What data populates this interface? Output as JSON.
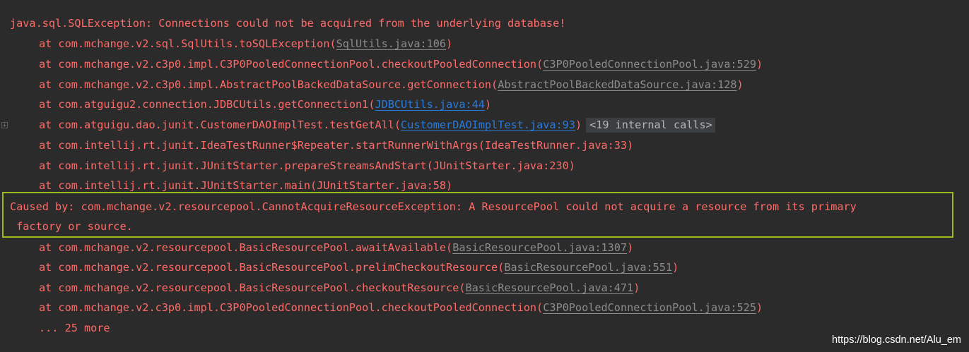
{
  "exception_header": "java.sql.SQLException: Connections could not be acquired from the underlying database!",
  "trace1": [
    {
      "method": "at com.mchange.v2.sql.SqlUtils.toSQLException(",
      "link": "SqlUtils.java:106",
      "close": ")"
    },
    {
      "method": "at com.mchange.v2.c3p0.impl.C3P0PooledConnectionPool.checkoutPooledConnection(",
      "link": "C3P0PooledConnectionPool.java:529",
      "close": ")"
    },
    {
      "method": "at com.mchange.v2.c3p0.impl.AbstractPoolBackedDataSource.getConnection(",
      "link": "AbstractPoolBackedDataSource.java:128",
      "close": ")"
    },
    {
      "method": "at com.atguigu2.connection.JDBCUtils.getConnection1(",
      "link": "JDBCUtils.java:44",
      "close": ")"
    },
    {
      "method": "at com.atguigu.dao.junit.CustomerDAOImplTest.testGetAll(",
      "link": "CustomerDAOImplTest.java:93",
      "close": ")",
      "internal": "<19 internal calls>"
    },
    {
      "text": "at com.intellij.rt.junit.IdeaTestRunner$Repeater.startRunnerWithArgs(IdeaTestRunner.java:33)"
    },
    {
      "text": "at com.intellij.rt.junit.JUnitStarter.prepareStreamsAndStart(JUnitStarter.java:230)"
    },
    {
      "text": "at com.intellij.rt.junit.JUnitStarter.main(JUnitStarter.java:58)"
    }
  ],
  "caused_by": {
    "line1": "Caused by: com.mchange.v2.resourcepool.CannotAcquireResourceException: A ResourcePool could not acquire a resource from its primary",
    "line2": " factory or source."
  },
  "trace2": [
    {
      "method": "at com.mchange.v2.resourcepool.BasicResourcePool.awaitAvailable(",
      "link": "BasicResourcePool.java:1307",
      "close": ")"
    },
    {
      "method": "at com.mchange.v2.resourcepool.BasicResourcePool.prelimCheckoutResource(",
      "link": "BasicResourcePool.java:551",
      "close": ")"
    },
    {
      "method": "at com.mchange.v2.resourcepool.BasicResourcePool.checkoutResource(",
      "link": "BasicResourcePool.java:471",
      "close": ")"
    },
    {
      "method": "at com.mchange.v2.c3p0.impl.C3P0PooledConnectionPool.checkoutPooledConnection(",
      "link": "C3P0PooledConnectionPool.java:525",
      "close": ")"
    }
  ],
  "more_text": "... 25 more",
  "gutter_fold_symbol": "+",
  "watermark": "https://blog.csdn.net/Alu_em",
  "colors": {
    "background": "#2b2b2b",
    "error_text": "#ff6b68",
    "user_link": "#287bde",
    "library_link": "#8c8c8c",
    "highlight_border": "#9bbb1c"
  }
}
